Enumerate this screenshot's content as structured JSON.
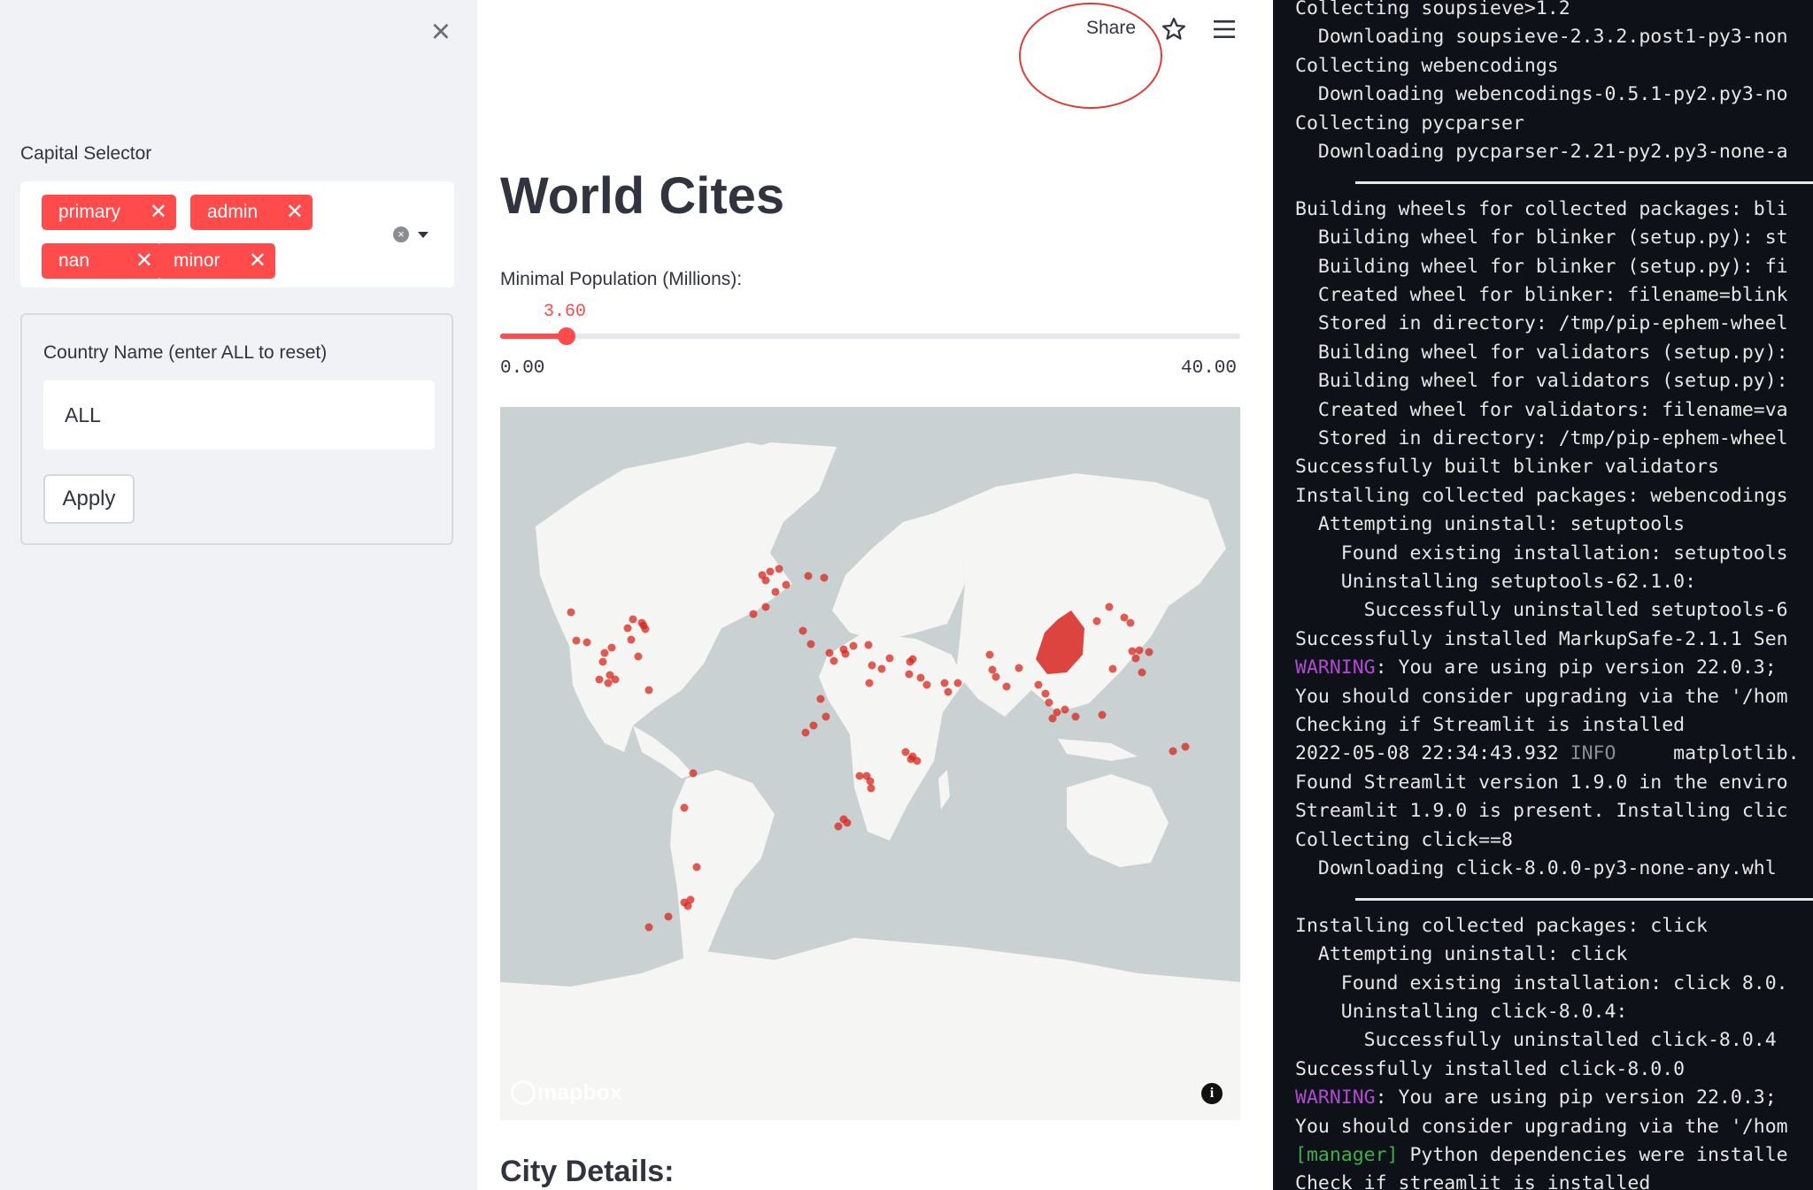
{
  "sidebar": {
    "close_icon": "close-icon",
    "capital_selector": {
      "label": "Capital Selector",
      "chips": [
        "primary",
        "admin",
        "nan",
        "minor"
      ],
      "chip_color": "#ff4b4b"
    },
    "country": {
      "label": "Country Name (enter ALL to reset)",
      "value": "ALL"
    },
    "apply_label": "Apply"
  },
  "header": {
    "share_label": "Share",
    "star_icon": "star-icon",
    "menu_icon": "hamburger-menu-icon"
  },
  "main": {
    "title": "World Cites",
    "slider": {
      "label": "Minimal Population (Millions):",
      "value": "3.60",
      "min": "0.00",
      "max": "40.00",
      "fraction": 0.09
    },
    "map": {
      "logo": "mapbox",
      "info_icon": "i",
      "dot_color": "#d7261e"
    },
    "section_heading": "City Details:"
  },
  "terminal": {
    "lines": [
      "Collecting soupsieve>1.2",
      "  Downloading soupsieve-2.3.2.post1-py3-non",
      "Collecting webencodings",
      "  Downloading webencodings-0.5.1-py2.py3-no",
      "Collecting pycparser",
      "  Downloading pycparser-2.21-py2.py3-none-a",
      "",
      "Building wheels for collected packages: bli",
      "  Building wheel for blinker (setup.py): st",
      "  Building wheel for blinker (setup.py): fi",
      "  Created wheel for blinker: filename=blink",
      "  Stored in directory: /tmp/pip-ephem-wheel",
      "  Building wheel for validators (setup.py):",
      "  Building wheel for validators (setup.py):",
      "  Created wheel for validators: filename=va",
      "  Stored in directory: /tmp/pip-ephem-wheel",
      "Successfully built blinker validators",
      "Installing collected packages: webencodings",
      "  Attempting uninstall: setuptools",
      "    Found existing installation: setuptools",
      "    Uninstalling setuptools-62.1.0:",
      "      Successfully uninstalled setuptools-6",
      "Successfully installed MarkupSafe-2.1.1 Sen",
      "WARNING: You are using pip version 22.0.3;",
      "You should consider upgrading via the '/hom",
      "Checking if Streamlit is installed",
      "2022-05-08 22:34:43.932 INFO     matplotlib.",
      "Found Streamlit version 1.9.0 in the enviro",
      "Streamlit 1.9.0 is present. Installing clic",
      "Collecting click==8",
      "  Downloading click-8.0.0-py3-none-any.whl",
      "",
      "Installing collected packages: click",
      "  Attempting uninstall: click",
      "    Found existing installation: click 8.0.",
      "    Uninstalling click-8.0.4:",
      "      Successfully uninstalled click-8.0.4",
      "Successfully installed click-8.0.0",
      "WARNING: You are using pip version 22.0.3;",
      "You should consider upgrading via the '/hom",
      "[manager] Python dependencies were installe",
      "Check if streamlit is installed"
    ],
    "colors": {
      "warning": "#b24ad1",
      "info": "#8b8e96",
      "manager": "#3fae4c"
    }
  }
}
